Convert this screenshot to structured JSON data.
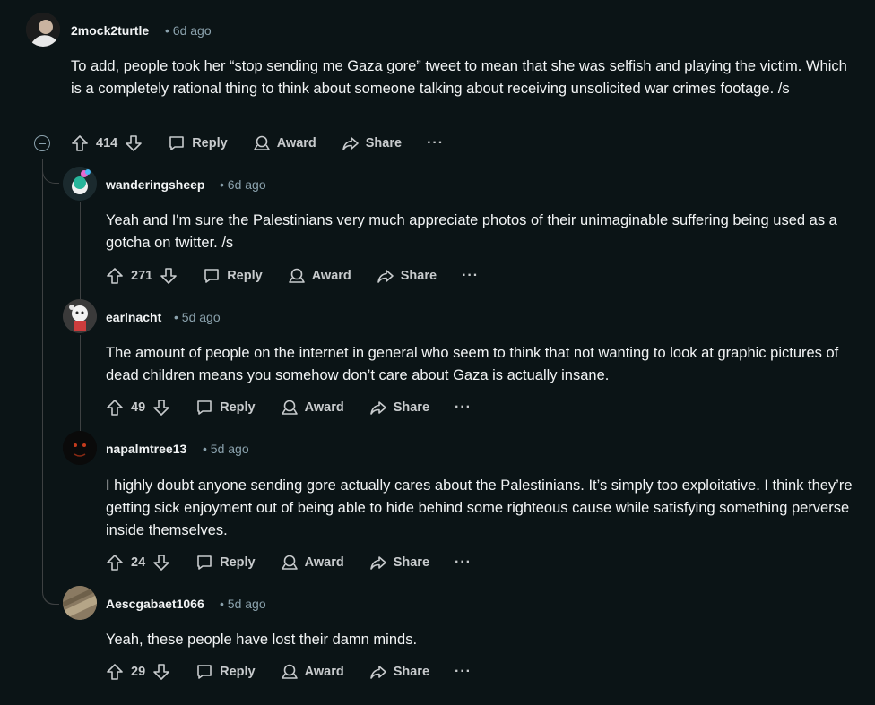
{
  "comments": [
    {
      "username": "2mock2turtle",
      "time": "6d ago",
      "body": "To add, people took her “stop sending me Gaza gore” tweet to mean that she was selfish and playing the victim. Which is a completely rational thing to think about someone talking about receiving unsolicited war crimes footage. /s",
      "votes": "414",
      "reply": "Reply",
      "award": "Award",
      "share": "Share",
      "more": "···"
    },
    {
      "username": "wanderingsheep",
      "time": "6d ago",
      "body": "Yeah and I'm sure the Palestinians very much appreciate photos of their unimaginable suffering being used as a gotcha on twitter. /s",
      "votes": "271",
      "reply": "Reply",
      "award": "Award",
      "share": "Share",
      "more": "···"
    },
    {
      "username": "earlnacht",
      "time": "5d ago",
      "body": "The amount of people on the internet in general who seem to think that not wanting to look at graphic pictures of dead children means you somehow don’t care about Gaza is actually insane.",
      "votes": "49",
      "reply": "Reply",
      "award": "Award",
      "share": "Share",
      "more": "···"
    },
    {
      "username": "napalmtree13",
      "time": "5d ago",
      "body": "I highly doubt anyone sending gore actually cares about the Palestinians. It’s simply too exploitative. I think they’re getting sick enjoyment out of being able to hide behind some righteous cause while satisfying something perverse inside themselves.",
      "votes": "24",
      "reply": "Reply",
      "award": "Award",
      "share": "Share",
      "more": "···"
    },
    {
      "username": "Aescgabaet1066",
      "time": "5d ago",
      "body": "Yeah, these people have lost their damn minds.",
      "votes": "29",
      "reply": "Reply",
      "award": "Award",
      "share": "Share",
      "more": "···"
    }
  ],
  "separator": "•",
  "icons": [
    "upvote-icon",
    "downvote-icon",
    "comment-icon",
    "award-icon",
    "share-icon",
    "collapse-icon"
  ],
  "colors": {
    "background": "#0b1416",
    "text": "#f2f4f5",
    "meta": "#8ba2ad"
  }
}
